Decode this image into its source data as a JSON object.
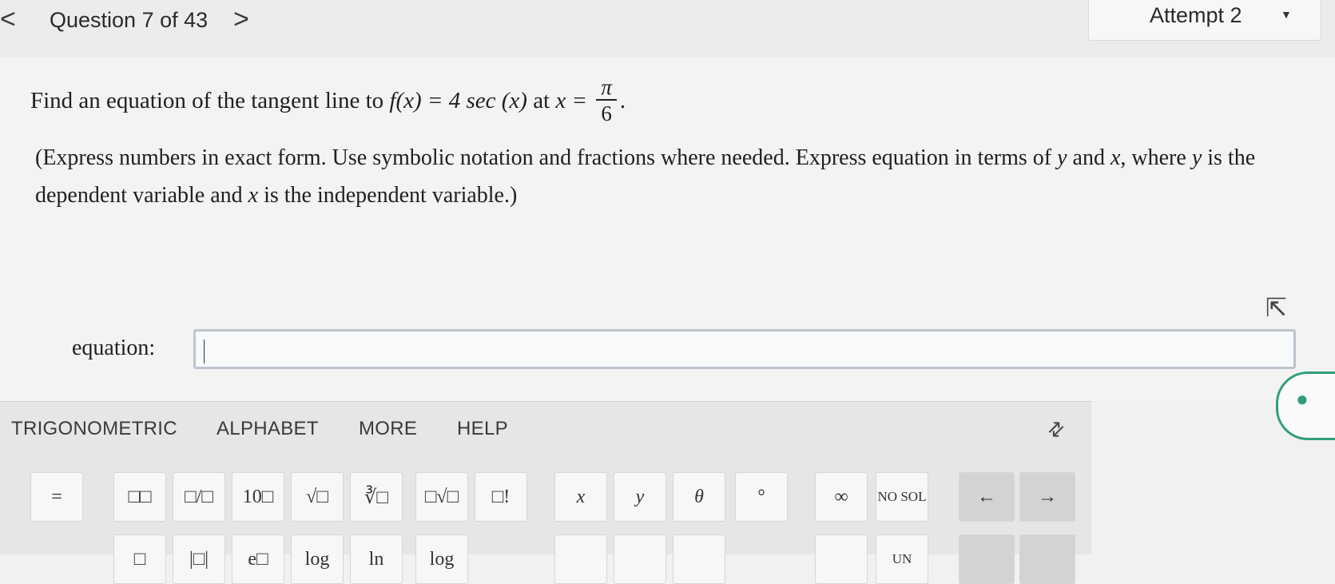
{
  "nav": {
    "prev": "<",
    "title": "Question 7 of 43",
    "next": ">"
  },
  "attempt": {
    "label": "Attempt 2",
    "caret": "▼"
  },
  "question": {
    "prefix": "Find an equation of the tangent line to",
    "func": "f(x) = 4 sec (x)",
    "at": "at",
    "x_eq": "x =",
    "frac_num": "π",
    "frac_den": "6",
    "period": "."
  },
  "instructions": {
    "part1": "(Express numbers in exact form. Use symbolic notation and fractions where needed. Express equation in terms of",
    "var_y": "y",
    "and": "and",
    "var_x": "x",
    "part2": ", where",
    "var_y2": "y",
    "part3": "is the dependent variable and",
    "var_x2": "x",
    "part4": "is the independent variable.)"
  },
  "answer": {
    "label": "equation:",
    "value": ""
  },
  "keypad": {
    "tabs": [
      "TRIGONOMETRIC",
      "ALPHABET",
      "MORE",
      "HELP"
    ],
    "row1": [
      "=",
      "□□",
      "□/□",
      "10□",
      "√□",
      "∛□",
      "□√□",
      "□!",
      "x",
      "y",
      "θ",
      "°",
      "∞",
      "NO SOL",
      "←",
      "→"
    ],
    "row2": [
      "□",
      "|□|",
      "e□",
      "log",
      "ln",
      "log",
      "UN"
    ]
  },
  "icons": {
    "pointer": "cursor-arrow-icon",
    "collapse": "collapse-arrows-icon",
    "helper": "lightbulb-icon"
  },
  "colors": {
    "accent": "#2f9f7a",
    "input_border": "#bcc5cf"
  }
}
